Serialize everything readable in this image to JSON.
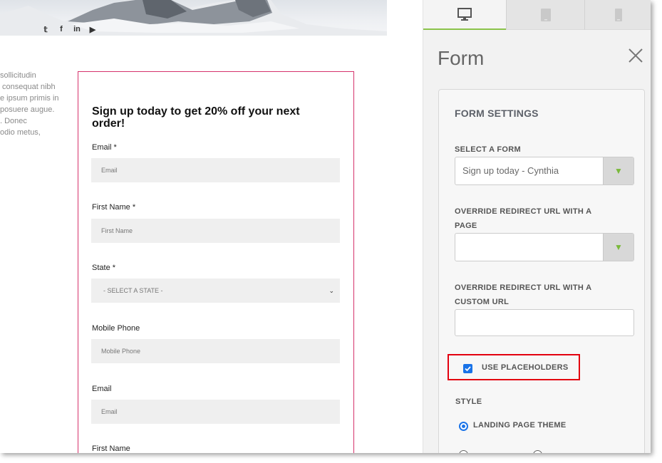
{
  "social": {
    "twitter": "𝕥",
    "facebook": "f",
    "linkedin": "in",
    "youtube": "▶"
  },
  "body_text": "sollicitudin\n consequat nibh\ne ipsum primis in\nposuere augue.\n. Donec\nodio metus,",
  "form_preview": {
    "title": "Sign up today to get 20% off your next order!",
    "fields": [
      {
        "label": "Email *",
        "placeholder": "Email"
      },
      {
        "label": "First Name *",
        "placeholder": "First Name"
      },
      {
        "label": "State *",
        "placeholder": "- SELECT A STATE -"
      },
      {
        "label": "Mobile Phone",
        "placeholder": "Mobile Phone"
      },
      {
        "label": "Email",
        "placeholder": "Email"
      },
      {
        "label": "First Name",
        "placeholder": ""
      }
    ]
  },
  "panel": {
    "tabs": [
      {
        "icon": "desktop-icon"
      },
      {
        "icon": "tablet-icon"
      },
      {
        "icon": "mobile-icon"
      }
    ],
    "title": "Form",
    "section_heading": "FORM SETTINGS",
    "select_form_label": "SELECT A FORM",
    "select_form_value": "Sign up today - Cynthia",
    "override_page_label": "OVERRIDE REDIRECT URL WITH A PAGE",
    "override_page_value": "",
    "override_url_label": "OVERRIDE REDIRECT URL WITH A CUSTOM URL",
    "override_url_value": "",
    "use_placeholders_label": "USE PLACEHOLDERS",
    "use_placeholders_checked": true,
    "style_label": "STYLE",
    "style_option_1": "LANDING PAGE THEME",
    "dropdown_arrow": "▼"
  },
  "colors": {
    "accent_green": "#8bc34a",
    "checkbox_blue": "#1a73e8",
    "highlight_red": "#e3000f",
    "form_border": "#d6336c"
  }
}
